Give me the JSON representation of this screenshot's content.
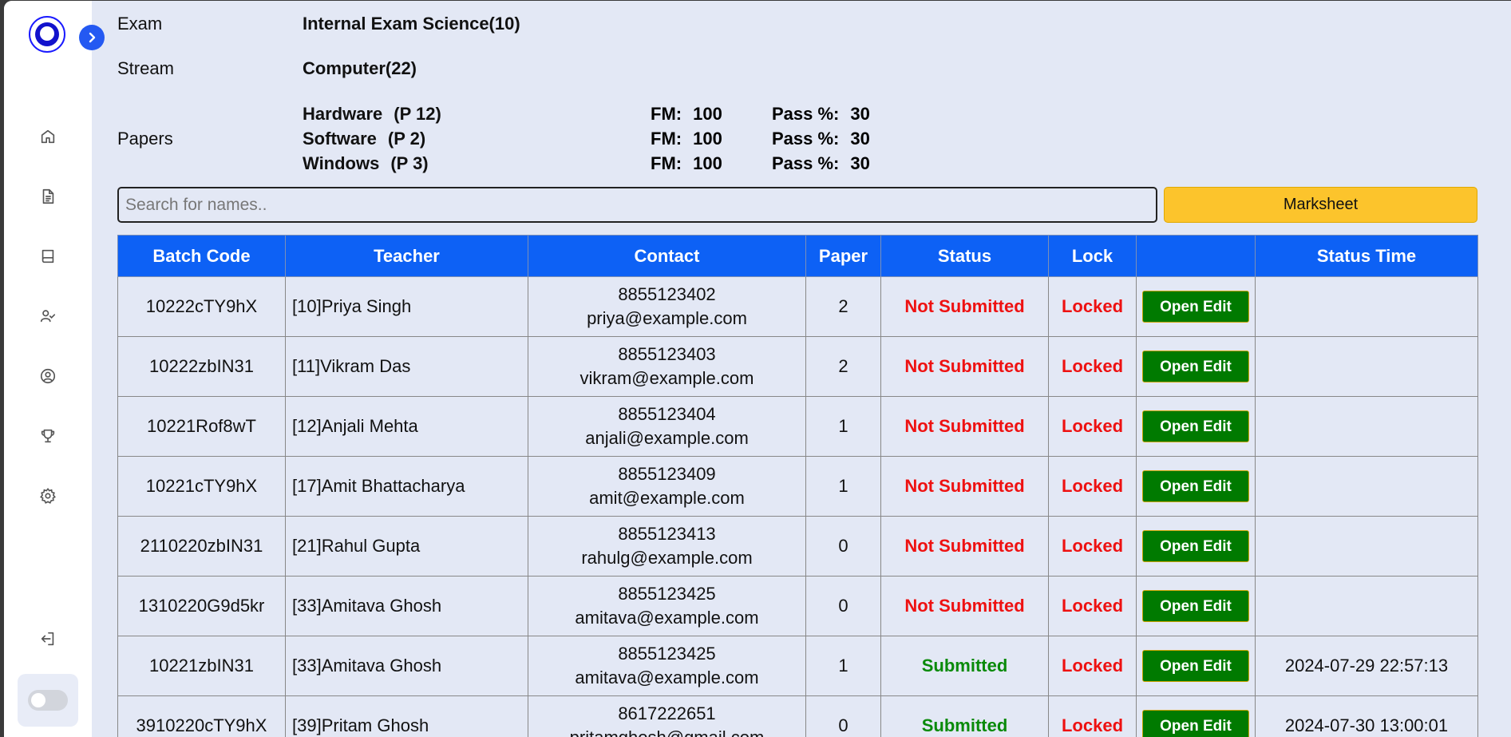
{
  "sidebar": {
    "icons": [
      "home-icon",
      "document-icon",
      "book-icon",
      "user-check-icon",
      "user-circle-icon",
      "trophy-icon",
      "settings-icon"
    ],
    "logout_icon": "logout-icon"
  },
  "exam": {
    "exam_label": "Exam",
    "exam_value": "Internal Exam Science(10)",
    "stream_label": "Stream",
    "stream_value": "Computer(22)",
    "papers_label": "Papers",
    "papers": [
      {
        "name": "Hardware",
        "code": "(P 12)",
        "fm_label": "FM:",
        "fm": "100",
        "pass_label": "Pass %:",
        "pass": "30"
      },
      {
        "name": "Software",
        "code": "(P 2)",
        "fm_label": "FM:",
        "fm": "100",
        "pass_label": "Pass %:",
        "pass": "30"
      },
      {
        "name": "Windows",
        "code": "(P 3)",
        "fm_label": "FM:",
        "fm": "100",
        "pass_label": "Pass %:",
        "pass": "30"
      }
    ]
  },
  "search": {
    "placeholder": "Search for names..",
    "value": ""
  },
  "marksheet_label": "Marksheet",
  "table": {
    "headers": [
      "Batch Code",
      "Teacher",
      "Contact",
      "Paper",
      "Status",
      "Lock",
      "",
      "Status Time"
    ],
    "action_label": "Open Edit",
    "rows": [
      {
        "batch": "10222cTY9hX",
        "teacher": "[10]Priya Singh",
        "phone": "8855123402",
        "email": "priya@example.com",
        "paper": "2",
        "status": "Not Submitted",
        "submitted": false,
        "lock": "Locked",
        "time": ""
      },
      {
        "batch": "10222zbIN31",
        "teacher": "[11]Vikram Das",
        "phone": "8855123403",
        "email": "vikram@example.com",
        "paper": "2",
        "status": "Not Submitted",
        "submitted": false,
        "lock": "Locked",
        "time": ""
      },
      {
        "batch": "10221Rof8wT",
        "teacher": "[12]Anjali Mehta",
        "phone": "8855123404",
        "email": "anjali@example.com",
        "paper": "1",
        "status": "Not Submitted",
        "submitted": false,
        "lock": "Locked",
        "time": ""
      },
      {
        "batch": "10221cTY9hX",
        "teacher": "[17]Amit Bhattacharya",
        "phone": "8855123409",
        "email": "amit@example.com",
        "paper": "1",
        "status": "Not Submitted",
        "submitted": false,
        "lock": "Locked",
        "time": ""
      },
      {
        "batch": "2110220zbIN31",
        "teacher": "[21]Rahul Gupta",
        "phone": "8855123413",
        "email": "rahulg@example.com",
        "paper": "0",
        "status": "Not Submitted",
        "submitted": false,
        "lock": "Locked",
        "time": ""
      },
      {
        "batch": "1310220G9d5kr",
        "teacher": "[33]Amitava Ghosh",
        "phone": "8855123425",
        "email": "amitava@example.com",
        "paper": "0",
        "status": "Not Submitted",
        "submitted": false,
        "lock": "Locked",
        "time": ""
      },
      {
        "batch": "10221zbIN31",
        "teacher": "[33]Amitava Ghosh",
        "phone": "8855123425",
        "email": "amitava@example.com",
        "paper": "1",
        "status": "Submitted",
        "submitted": true,
        "lock": "Locked",
        "time": "2024-07-29 22:57:13"
      },
      {
        "batch": "3910220cTY9hX",
        "teacher": "[39]Pritam Ghosh",
        "phone": "8617222651",
        "email": "pritamghosh@gmail.com",
        "paper": "0",
        "status": "Submitted",
        "submitted": true,
        "lock": "Locked",
        "time": "2024-07-30 13:00:01"
      }
    ]
  },
  "colors": {
    "accent": "#0d61f5",
    "marksheet": "#fcc42c",
    "error": "#ee1111",
    "success": "#0a8a0a",
    "action": "#007a00"
  }
}
